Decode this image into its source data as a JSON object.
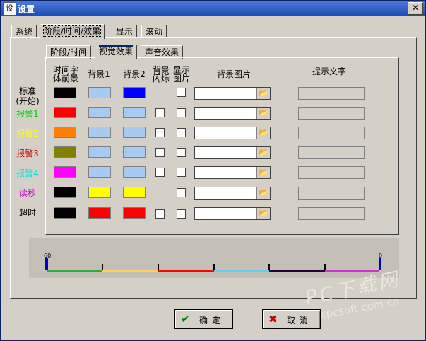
{
  "window": {
    "title": "设置",
    "app_icon_text": "设"
  },
  "top_tabs": [
    "系统",
    "阶段/时间/效果",
    "显示",
    "滚动"
  ],
  "sub_tabs": [
    "阶段/时间",
    "视觉效果",
    "声音效果"
  ],
  "columns": {
    "font_fg": "时间字\n体前景",
    "bg1": "背景1",
    "bg2": "背景2",
    "bg_flash": "背景\n闪烁",
    "show_img": "显示\n图片",
    "bg_image": "背景图片",
    "hint_text": "提示文字"
  },
  "rows": [
    {
      "label": "标准\n(开始)",
      "label_color": "#000000",
      "fg": "#000000",
      "bg1": "#a6caf0",
      "bg2": "#0000ff",
      "flash": false
    },
    {
      "label": "报警1",
      "label_color": "#00cc00",
      "fg": "#ff0000",
      "bg1": "#a6caf0",
      "bg2": "#a6caf0",
      "flash": true
    },
    {
      "label": "报警2",
      "label_color": "#ffff00",
      "fg": "#ff8000",
      "bg1": "#a6caf0",
      "bg2": "#a6caf0",
      "flash": true
    },
    {
      "label": "报警3",
      "label_color": "#cc0000",
      "fg": "#808000",
      "bg1": "#a6caf0",
      "bg2": "#a6caf0",
      "flash": true
    },
    {
      "label": "报警4",
      "label_color": "#00e0e0",
      "fg": "#ff00ff",
      "bg1": "#a6caf0",
      "bg2": "#a6caf0",
      "flash": true
    },
    {
      "label": "读秒",
      "label_color": "#c000c0",
      "fg": "#000000",
      "bg1": "#ffff00",
      "bg2": "#ffff00",
      "flash": false
    },
    {
      "label": "超时",
      "label_color": "#000000",
      "fg": "#000000",
      "bg1": "#ff0000",
      "bg2": "#ff0000",
      "flash": true
    }
  ],
  "scale": {
    "start": "60",
    "end": "0",
    "segment_colors": [
      "#33aa33",
      "#ffcc66",
      "#ff0000",
      "#66ccee",
      "#220033",
      "#cc33cc"
    ]
  },
  "buttons": {
    "ok": "确定",
    "cancel": "取消"
  },
  "watermark": {
    "line1": "PC下载网",
    "line2": "www.pcsoft.com.cn"
  },
  "icons": {
    "browse": "folder-open-icon",
    "ok": "check-icon",
    "cancel": "x-icon"
  }
}
